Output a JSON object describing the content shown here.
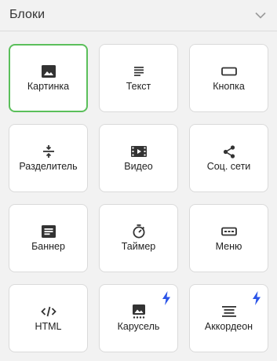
{
  "header": {
    "title": "Блоки"
  },
  "colors": {
    "accent_selected": "#5bbf5b",
    "premium_bolt": "#2a54e8",
    "icon": "#333333"
  },
  "tiles": [
    {
      "id": "image",
      "label": "Картинка",
      "icon": "image-icon",
      "selected": true,
      "premium": false
    },
    {
      "id": "text",
      "label": "Текст",
      "icon": "text-icon",
      "selected": false,
      "premium": false
    },
    {
      "id": "button",
      "label": "Кнопка",
      "icon": "button-icon",
      "selected": false,
      "premium": false
    },
    {
      "id": "divider",
      "label": "Разделитель",
      "icon": "divider-icon",
      "selected": false,
      "premium": false
    },
    {
      "id": "video",
      "label": "Видео",
      "icon": "video-icon",
      "selected": false,
      "premium": false
    },
    {
      "id": "social",
      "label": "Соц. сети",
      "icon": "share-icon",
      "selected": false,
      "premium": false
    },
    {
      "id": "banner",
      "label": "Баннер",
      "icon": "banner-icon",
      "selected": false,
      "premium": false
    },
    {
      "id": "timer",
      "label": "Таймер",
      "icon": "timer-icon",
      "selected": false,
      "premium": false
    },
    {
      "id": "menu",
      "label": "Меню",
      "icon": "menu-icon",
      "selected": false,
      "premium": false
    },
    {
      "id": "html",
      "label": "HTML",
      "icon": "code-icon",
      "selected": false,
      "premium": false
    },
    {
      "id": "carousel",
      "label": "Карусель",
      "icon": "carousel-icon",
      "selected": false,
      "premium": true
    },
    {
      "id": "accordion",
      "label": "Аккордеон",
      "icon": "accordion-icon",
      "selected": false,
      "premium": true
    }
  ]
}
